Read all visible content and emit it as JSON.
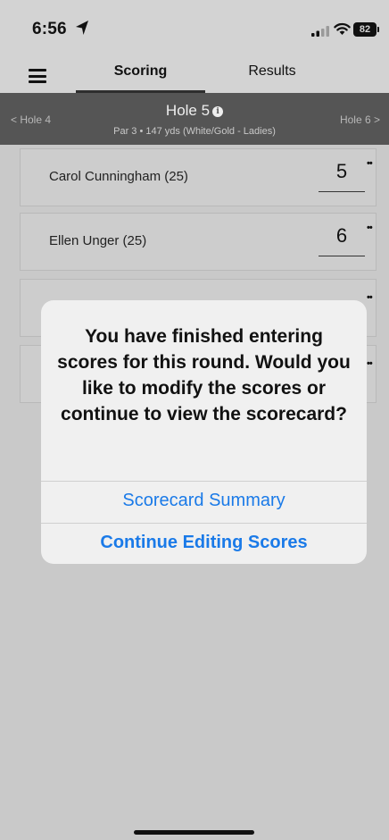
{
  "status_bar": {
    "time": "6:56",
    "battery": "82",
    "location_icon": "location-arrow-icon",
    "signal_icon": "cellular-signal-icon",
    "wifi_icon": "wifi-icon"
  },
  "nav": {
    "menu_icon": "hamburger-menu-icon",
    "tabs": [
      {
        "label": "Scoring",
        "active": true
      },
      {
        "label": "Results",
        "active": false
      }
    ]
  },
  "hole_header": {
    "prev": "< Hole 4",
    "title": "Hole 5",
    "subtitle": "Par 3 • 147 yds (White/Gold - Ladies)",
    "next": "Hole 6 >",
    "info_icon": "info-icon"
  },
  "players": [
    {
      "name": "Carol Cunningham (25)",
      "score": "5",
      "dots": "••"
    },
    {
      "name": "Ellen Unger (25)",
      "score": "6",
      "dots": "••"
    },
    {
      "name": "",
      "score": "",
      "dots": "••"
    },
    {
      "name": "",
      "score": "",
      "dots": "••"
    }
  ],
  "dialog": {
    "message": "You have finished entering scores for this round. Would you like to modify the scores or continue to view the scorecard?",
    "button_summary": "Scorecard Summary",
    "button_continue": "Continue Editing Scores"
  },
  "colors": {
    "accent": "#1a7ae8",
    "header_bg": "#555555",
    "overlay_bg": "#c9c9c9"
  }
}
